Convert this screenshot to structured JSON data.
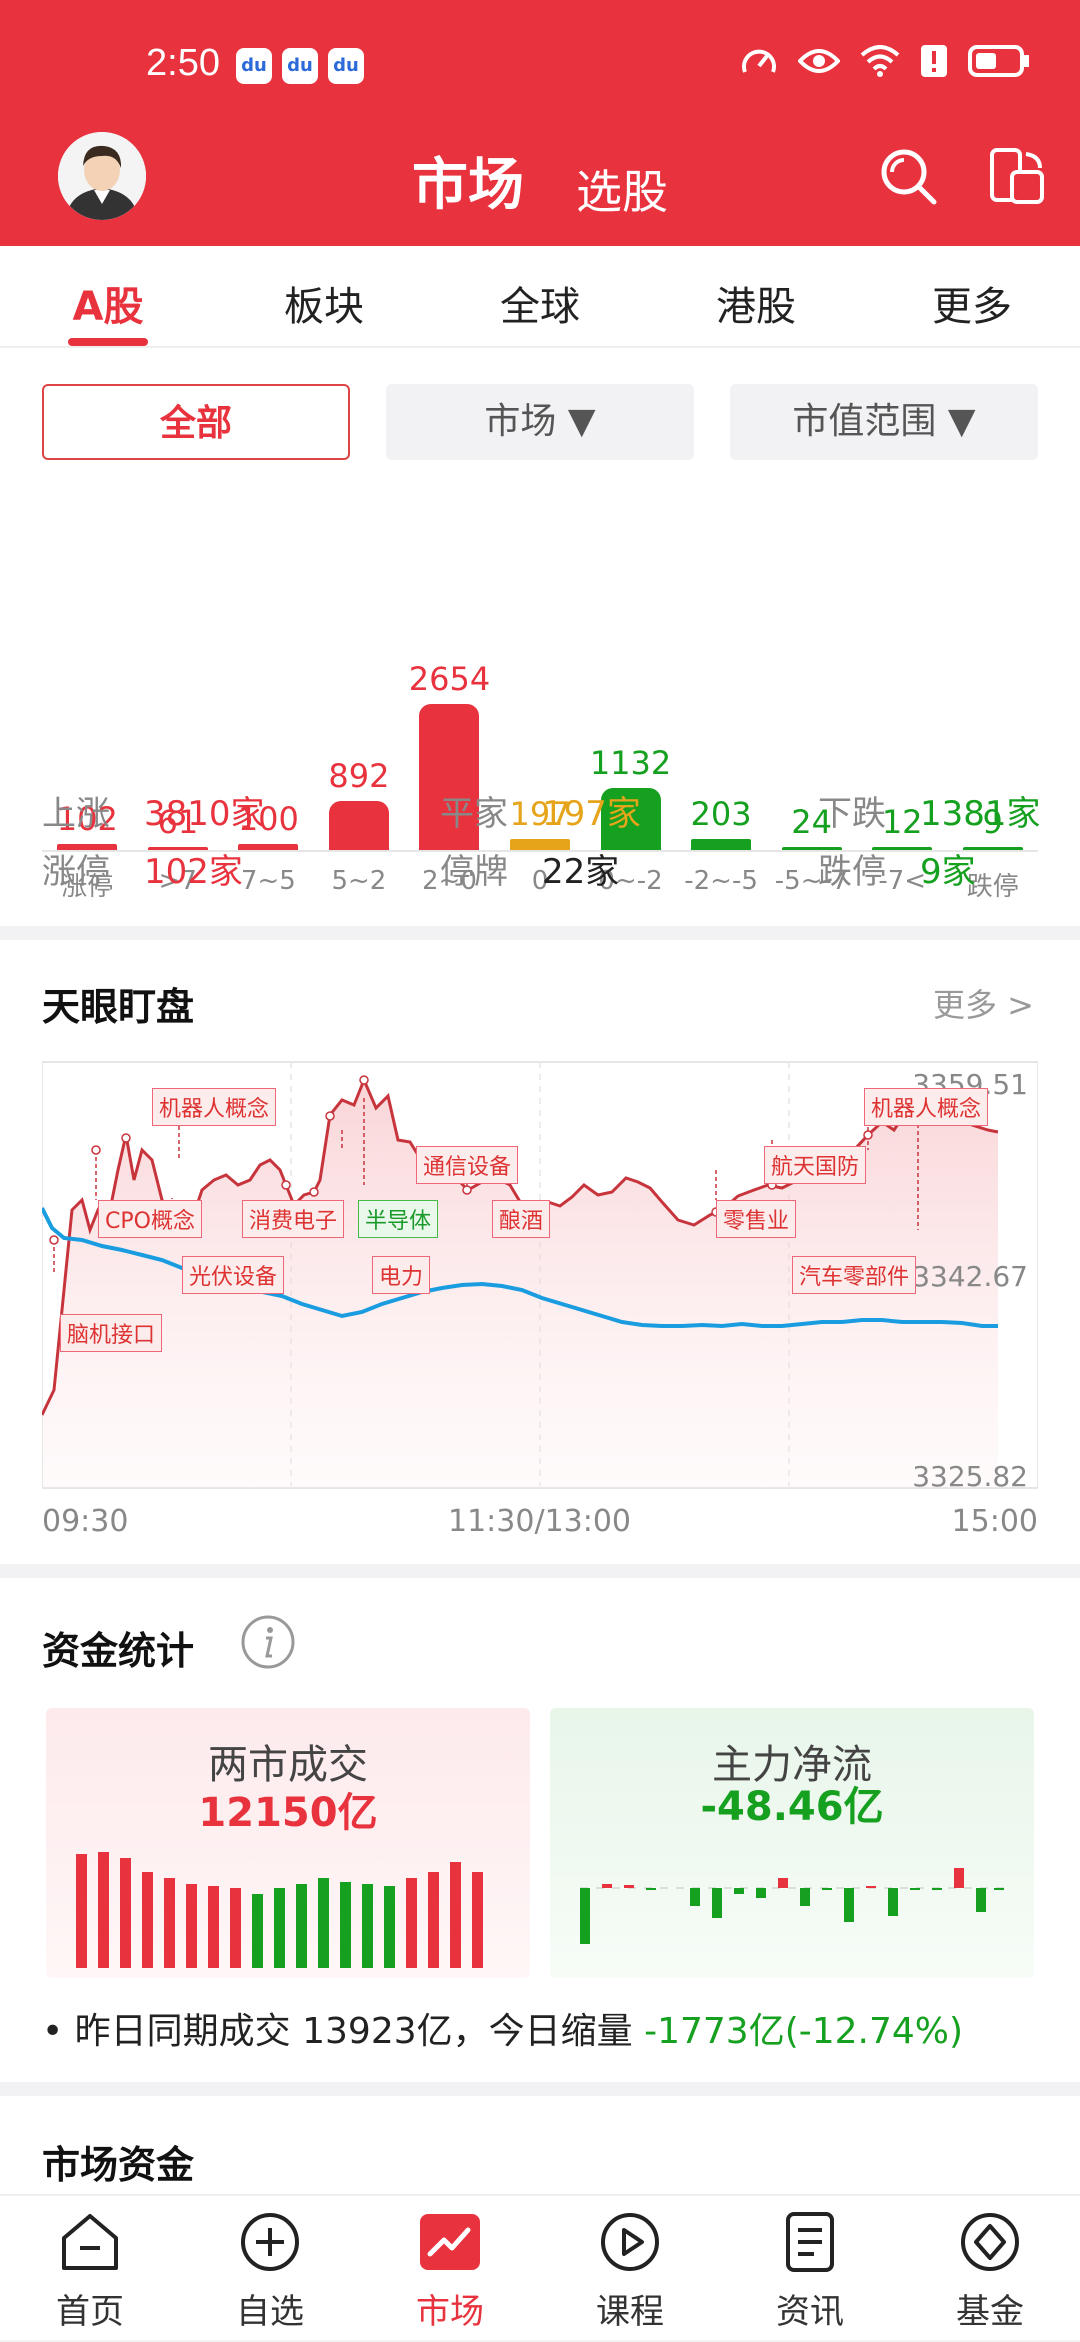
{
  "status_bar": {
    "time": "2:50",
    "notif_icons": [
      "baidu-icon",
      "baidu-icon",
      "baidu-icon"
    ]
  },
  "header": {
    "title": "市场",
    "subtitle": "选股"
  },
  "tabs": [
    "A股",
    "板块",
    "全球",
    "港股",
    "更多"
  ],
  "filters": {
    "all": "全部",
    "market": "市场 ▼",
    "cap": "市值范围 ▼"
  },
  "distribution": {
    "values": [
      "102",
      "61",
      "100",
      "892",
      "2654",
      "197",
      "1132",
      "203",
      "24",
      "12",
      "9"
    ],
    "labels": [
      "涨停",
      ">7",
      "7~5",
      "5~2",
      "2~0",
      "0",
      "0~-2",
      "-2~-5",
      "-5~-7",
      "-7<",
      "跌停"
    ],
    "numbers": [
      102,
      61,
      100,
      892,
      2654,
      197,
      1132,
      203,
      24,
      12,
      9
    ],
    "colors": [
      "#e8333e",
      "#e8333e",
      "#e8333e",
      "#e8333e",
      "#e8333e",
      "#e6a41a",
      "#16a020",
      "#16a020",
      "#16a020",
      "#16a020",
      "#16a020"
    ]
  },
  "stats": {
    "up_label": "上涨",
    "up_value": "3810家",
    "flat_label": "平家",
    "flat_value": "197家",
    "down_label": "下跌",
    "down_value": "1381家",
    "limit_up_label": "涨停",
    "limit_up_value": "102家",
    "halt_label": "停牌",
    "halt_value": "22家",
    "limit_down_label": "跌停",
    "limit_down_value": "9家"
  },
  "tianyan": {
    "title": "天眼盯盘",
    "more": "更多 >",
    "y_high": "3359.51",
    "y_mid": "3342.67",
    "y_low": "3325.82",
    "t_start": "09:30",
    "t_mid": "11:30/13:00",
    "t_end": "15:00",
    "tags": [
      "机器人概念",
      "CPO概念",
      "光伏设备",
      "脑机接口",
      "消费电子",
      "半导体",
      "电力",
      "通信设备",
      "酿酒",
      "零售业",
      "航天国防",
      "机器人概念",
      "汽车零部件"
    ]
  },
  "funds": {
    "title": "资金统计",
    "turnover_label": "两市成交",
    "turnover_value": "12150亿",
    "main_label": "主力净流",
    "main_value": "-48.46亿",
    "summary_prefix": "• 昨日同期成交 13923亿，今日缩量 ",
    "summary_change": "-1773亿(-12.74%)"
  },
  "next_section": {
    "title": "市场资金"
  },
  "bottom_nav": [
    "首页",
    "自选",
    "市场",
    "课程",
    "资讯",
    "基金"
  ],
  "colors": {
    "brand_red": "#e8333e",
    "green": "#16a020",
    "amber": "#e6a41a",
    "blue_line": "#1a9de0"
  }
}
